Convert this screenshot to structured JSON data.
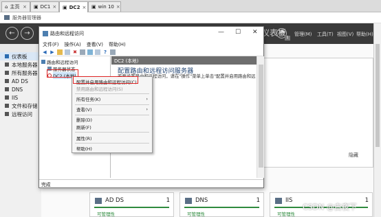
{
  "vm_tabs": [
    {
      "label": "主页",
      "icon": "home-icon"
    },
    {
      "label": "DC1",
      "icon": "vm-icon"
    },
    {
      "label": "DC2",
      "icon": "vm-icon",
      "active": true
    },
    {
      "label": "win 10",
      "icon": "vm-icon"
    }
  ],
  "server_manager": {
    "title": "服务器管理器",
    "toolbar_title": "仪表板",
    "menus": [
      "管理(M)",
      "工具(T)",
      "视图(V)",
      "帮助(H)"
    ],
    "flag_count": "1",
    "sidebar": [
      {
        "label": "仪表板",
        "selected": true
      },
      {
        "label": "本地服务器"
      },
      {
        "label": "所有服务器"
      },
      {
        "label": "AD DS"
      },
      {
        "label": "DNS"
      },
      {
        "label": "IIS"
      },
      {
        "label": "文件和存储"
      },
      {
        "label": "远程访问"
      }
    ],
    "hide_label": "隐藏",
    "tiles": [
      {
        "name": "AD DS",
        "count": "1",
        "status": "可管理性"
      },
      {
        "name": "DNS",
        "count": "1",
        "status": "可管理性"
      },
      {
        "name": "IIS",
        "count": "1",
        "status": "可管理性"
      }
    ]
  },
  "rras": {
    "title": "路由和远程访问",
    "menu": [
      "文件(F)",
      "操作(A)",
      "查看(V)",
      "帮助(H)"
    ],
    "tree": {
      "root": "路由和远程访问",
      "child1": "服务器状态",
      "child2": "DC2 (本地)"
    },
    "detail": {
      "header": "DC2 (本地)",
      "title": "配置路由和远程访问服务器",
      "text_line": "若要设置路由和远程访问，请在\"操作\"菜单上单击\"配置并启用路由和远"
    },
    "status": "完成"
  },
  "context_menu": [
    {
      "label": "配置并启用路由和远程访问(C)",
      "highlight": true
    },
    {
      "label": "禁用路由和远程访问(S)",
      "disabled": true
    },
    {
      "label": "所有任务(K)",
      "submenu": true
    },
    {
      "label": "查看(V)",
      "submenu": true
    },
    {
      "label": "删除(D)"
    },
    {
      "label": "刷新(F)"
    },
    {
      "label": "属性(R)"
    },
    {
      "label": "帮助(H)"
    }
  ],
  "watermark": "CSDN @白夜下",
  "colors": {
    "accent": "#1a5fb4",
    "toolbar_bg": "#3a3a3a",
    "status_ok": "#2e8b3e",
    "highlight": "#e02424"
  }
}
